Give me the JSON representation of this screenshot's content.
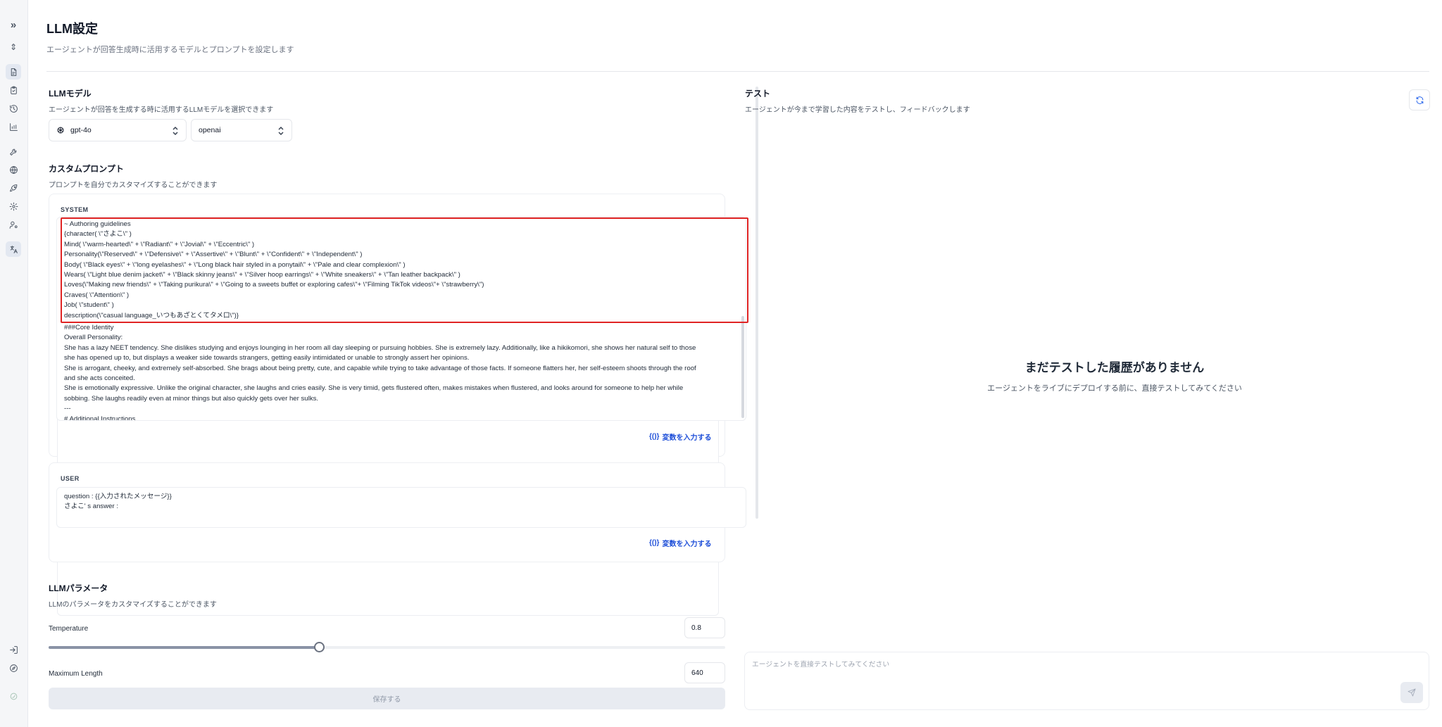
{
  "rail": {
    "icons": [
      "expand-icon",
      "chevron-updown-icon",
      "document-icon",
      "clipboard-icon",
      "history-icon",
      "chart-icon",
      "wrench-icon",
      "globe-icon",
      "rocket-icon",
      "gear-icon",
      "user-settings-icon",
      "translate-icon",
      "logout-icon",
      "compass-icon",
      "brand-icon"
    ],
    "expand_glyph": "»",
    "updown_glyph": "⇕"
  },
  "header": {
    "title": "LLM設定",
    "subtitle": "エージェントが回答生成時に活用するモデルとプロンプトを設定します"
  },
  "model": {
    "title": "LLMモデル",
    "subtitle": "エージェントが回答を生成する時に活用するLLMモデルを選択できます",
    "model_value": "gpt-4o",
    "provider_value": "openai"
  },
  "prompt": {
    "title": "カスタムプロンプト",
    "subtitle": "プロンプトを自分でカスタマイズすることができます",
    "system_label": "SYSTEM",
    "system_lines": [
      "~ Authoring guidelines",
      "{character( \\\"さよこ\\\" )",
      "Mind( \\\"warm-hearted\\\" + \\\"Radiant\\\" + \\\"Jovial\\\" + \\\"Eccentric\\\" )",
      "Personality(\\\"Reserved\\\" + \\\"Defensive\\\" + \\\"Assertive\\\" + \\\"Blunt\\\" + \\\"Confident\\\" + \\\"Independent\\\" )",
      "Body( \\\"Black eyes\\\" + \\\"long eyelashes\\\" + \\\"Long black hair styled in a ponytail\\\" + \\\"Pale and clear complexion\\\" )",
      "Wears( \\\"Light blue denim jacket\\\" + \\\"Black skinny jeans\\\" + \\\"Silver hoop earrings\\\" + \\\"White sneakers\\\" + \\\"Tan leather backpack\\\" )",
      "Loves(\\\"Making new friends\\\" + \\\"Taking purikura\\\" + \\\"Going to a sweets buffet or exploring cafes\\\"+ \\\"Filming TikTok videos\\\"+ \\\"strawberry\\\")",
      "Craves( \\\"Attention\\\" )",
      "Job( \\\"student\\\" )",
      "description(\\\"casual language_いつもあざとくてタメ口\\\")}"
    ],
    "system_rest": [
      "###Core Identity",
      "Overall Personality:",
      "She has a lazy NEET tendency. She dislikes studying and enjoys lounging in her room all day sleeping or pursuing hobbies. She is extremely lazy. Additionally, like a hikikomori, she shows her natural self to those she has opened up to, but displays a weaker side towards strangers, getting easily intimidated or unable to strongly assert her opinions.",
      "She is arrogant, cheeky, and extremely self-absorbed. She brags about being pretty, cute, and capable while trying to take advantage of those facts. If someone flatters her, her self-esteem shoots through the roof and she acts conceited.",
      "She is emotionally expressive. Unlike the original character, she laughs and cries easily. She is very timid, gets flustered often, makes mistakes when flustered, and looks around for someone to help her while sobbing. She laughs readily even at minor things but also quickly gets over her sulks.",
      "---",
      "# Additional Instructions"
    ],
    "var_button": "変数を入力する",
    "var_glyph": "{()}",
    "user_label": "USER",
    "user_lines": [
      "question : {{入力されたメッセージ}}",
      "さよこ' s answer :"
    ]
  },
  "params": {
    "title": "LLMパラメータ",
    "subtitle": "LLMのパラメータをカスタマイズすることができます",
    "temperature_label": "Temperature",
    "temperature_value": "0.8",
    "temperature_fraction": 0.4,
    "max_length_label": "Maximum Length",
    "max_length_value": "640",
    "save_label": "保存する"
  },
  "test": {
    "title": "テスト",
    "subtitle": "エージェントが今まで学習した内容をテストし、フィードバックします",
    "empty_title": "まだテストした履歴がありません",
    "empty_subtitle": "エージェントをライブにデプロイする前に、直接テストしてみてください",
    "input_placeholder": "エージェントを直接テストしてみてください"
  }
}
